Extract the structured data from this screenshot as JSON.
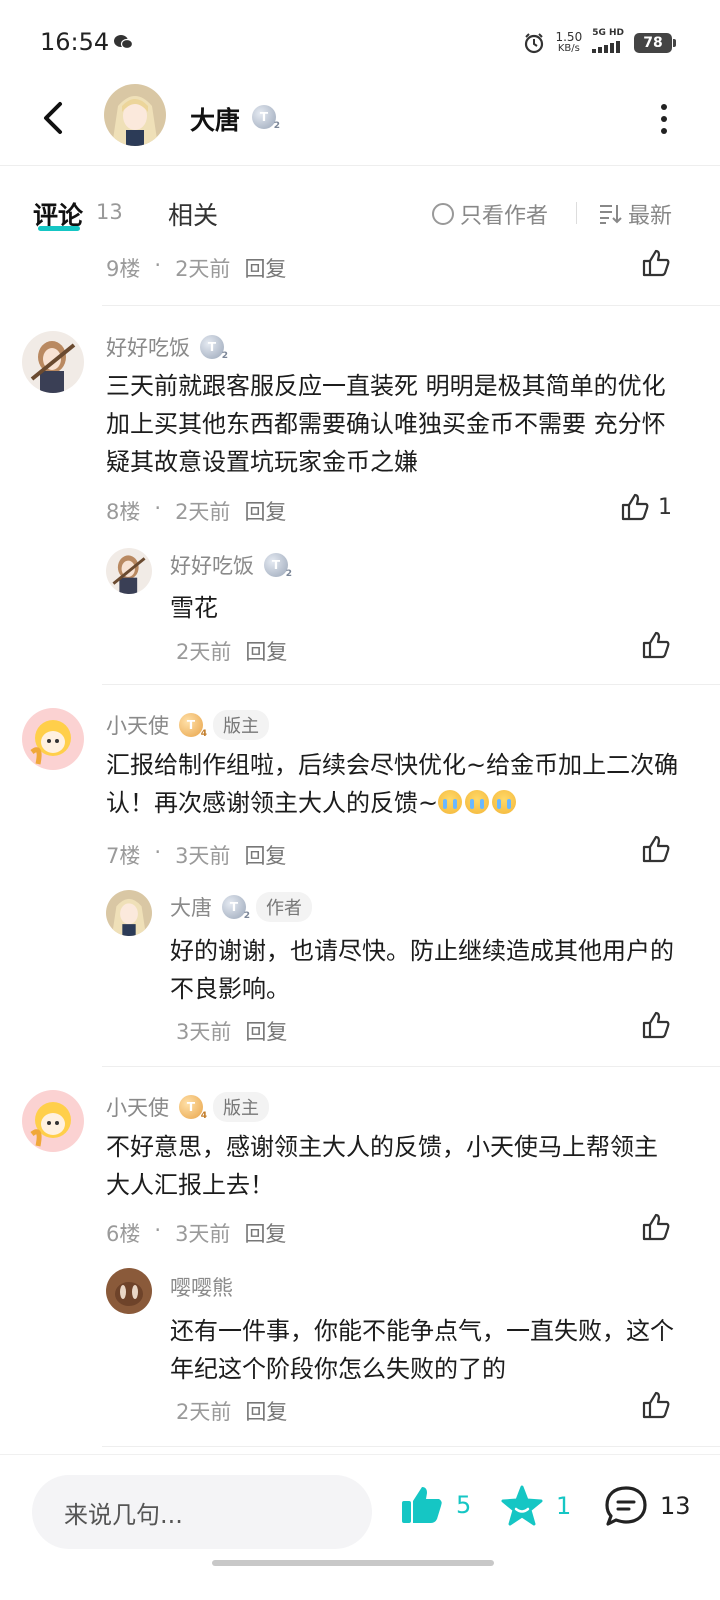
{
  "status": {
    "time": "16:54",
    "speed": "1.50",
    "speed_unit": "KB/s",
    "network": "5G HD",
    "battery": "78"
  },
  "header": {
    "author_name": "大唐",
    "author_level": "T",
    "level_sub": "2"
  },
  "tabs": {
    "comments_label": "评论",
    "comments_count": "13",
    "related_label": "相关"
  },
  "filters": {
    "author_only": "只看作者",
    "sort": "最新"
  },
  "colors": {
    "accent": "#15c6c4"
  },
  "comments": [
    {
      "floor": "9楼",
      "time": "2天前",
      "reply": "回复"
    },
    {
      "user": "好好吃饭",
      "level": "T",
      "level_sub": "2",
      "text": "三天前就跟客服反应一直装死 明明是极其简单的优化 加上买其他东西都需要确认唯独买金币不需要 充分怀疑其故意设置坑玩家金币之嫌",
      "floor": "8楼",
      "time": "2天前",
      "reply": "回复",
      "likes": "1",
      "replies": [
        {
          "user": "好好吃饭",
          "level": "T",
          "level_sub": "2",
          "text": "雪花",
          "time": "2天前",
          "reply": "回复"
        }
      ]
    },
    {
      "user": "小天使",
      "level": "T",
      "level_sub": "4",
      "tag": "版主",
      "text": "汇报给制作组啦，后续会尽快优化~给金币加上二次确认！再次感谢领主大人的反馈~",
      "floor": "7楼",
      "time": "3天前",
      "reply": "回复",
      "replies": [
        {
          "user": "大唐",
          "level": "T",
          "level_sub": "2",
          "tag": "作者",
          "text": "好的谢谢，也请尽快。防止继续造成其他用户的不良影响。",
          "time": "3天前",
          "reply": "回复"
        }
      ]
    },
    {
      "user": "小天使",
      "level": "T",
      "level_sub": "4",
      "tag": "版主",
      "text": "不好意思，感谢领主大人的反馈，小天使马上帮领主大人汇报上去！",
      "floor": "6楼",
      "time": "3天前",
      "reply": "回复",
      "replies": [
        {
          "user": "嘤嘤熊",
          "text": "还有一件事，你能不能争点气，一直失败，这个年纪这个阶段你怎么失败的了的",
          "time": "2天前",
          "reply": "回复"
        }
      ]
    }
  ],
  "bottom": {
    "placeholder": "来说几句...",
    "likes": "5",
    "favorites": "1",
    "comments": "13"
  }
}
